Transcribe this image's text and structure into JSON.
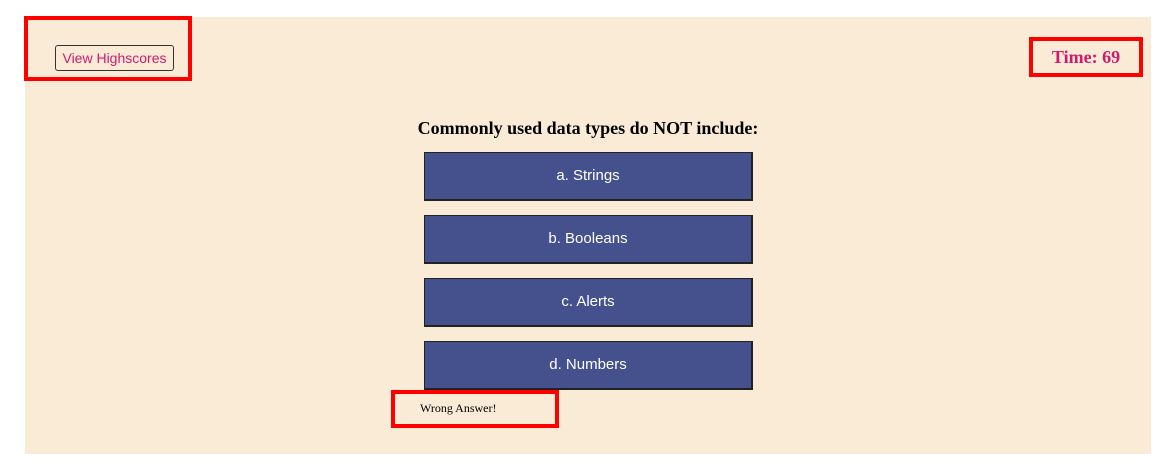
{
  "header": {
    "highscores_label": "View Highscores",
    "timer_text": "Time: 69"
  },
  "quiz": {
    "question": "Commonly used data types do NOT include:",
    "choices": [
      "a. Strings",
      "b. Booleans",
      "c. Alerts",
      "d. Numbers"
    ],
    "feedback": "Wrong Answer!"
  },
  "colors": {
    "background": "#faebd7",
    "accent": "#d1196e",
    "button": "#44518d",
    "highlight": "#ff0000"
  }
}
